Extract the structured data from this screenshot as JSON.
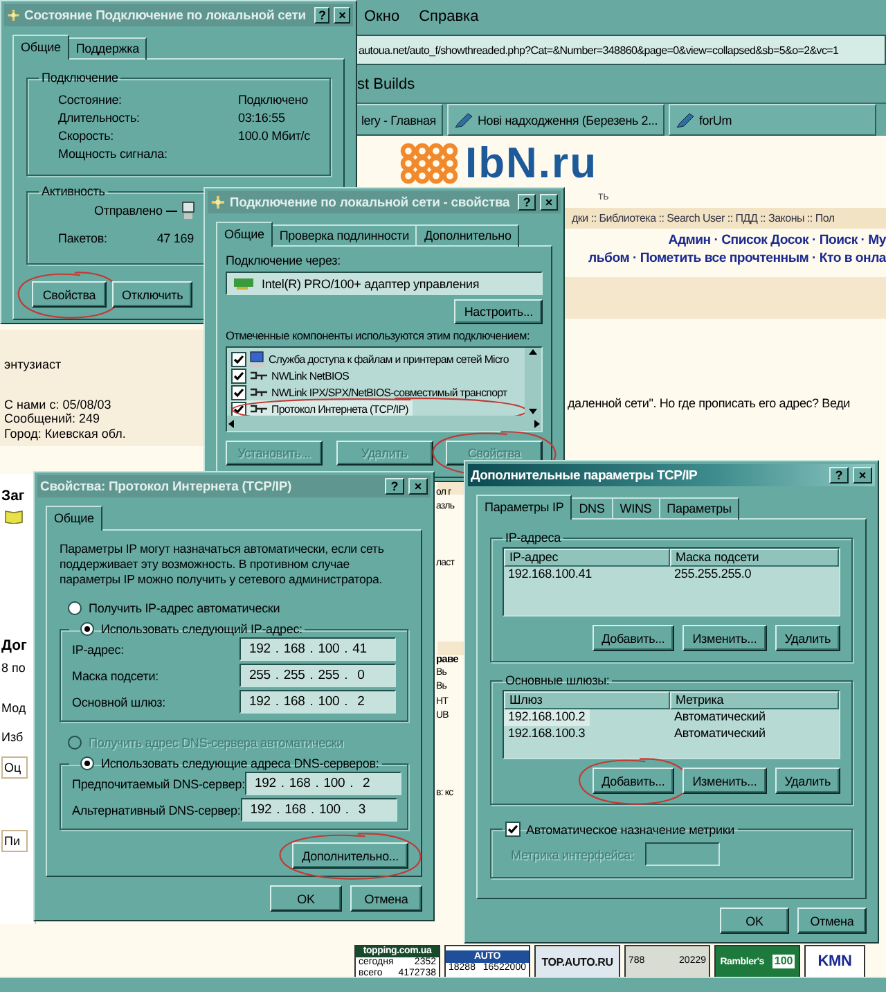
{
  "browser": {
    "menu": [
      {
        "label": "Окно"
      },
      {
        "label": "Справка"
      }
    ],
    "address": "autoua.net/auto_f/showthreaded.php?Cat=&Number=348860&page=0&view=collapsed&sb=5&o=2&vc=1",
    "links": [
      "st Builds"
    ],
    "tabs": [
      {
        "label": "lery - Главная",
        "kind": "plain"
      },
      {
        "label": "Нові надходження (Березень 2...",
        "kind": "edit"
      },
      {
        "label": "forUm",
        "kind": "edit"
      }
    ],
    "logo": {
      "text": "IbN.ru",
      "tagline": "ть"
    },
    "nav": "дки :: Библиотека :: Search User :: ПДД :: Законы :: Пол",
    "actions": [
      "Админ · Список Досок · Поиск · Му",
      "льбом · Пометить все прочтенным · Кто в онла"
    ],
    "profile": [
      "энтузиаст",
      "С нами с: 05/08/03",
      "Сообщений: 249",
      "Город: Киевская обл."
    ],
    "post": "даленной сети\". Но где прописать его адрес? Веди",
    "left_fragments": [
      {
        "text": "Заг",
        "kind": "heading"
      },
      {
        "text": "Дог",
        "kind": "heading"
      },
      {
        "text": "8 по",
        "kind": "text"
      },
      {
        "text": "Мод",
        "kind": "text"
      },
      {
        "text": "Изб",
        "kind": "text"
      },
      {
        "text": "Оц",
        "kind": "boxed"
      },
      {
        "text": "Пи",
        "kind": "boxed"
      }
    ],
    "middle_fragments": [
      {
        "text": "ол г",
        "kind": "text"
      },
      {
        "text": "азль",
        "kind": "text"
      },
      {
        "text": "ласт",
        "kind": "text"
      },
      {
        "text": "раве",
        "kind": "heading"
      },
      {
        "text": "Вь",
        "kind": "text"
      },
      {
        "text": "Вь",
        "kind": "text"
      },
      {
        "text": "НТ",
        "kind": "text"
      },
      {
        "text": "UB",
        "kind": "text"
      },
      {
        "text": "в: кс",
        "kind": "text"
      }
    ],
    "banners": [
      {
        "kind": "dark",
        "title": "topping.com.ua",
        "rows": [
          [
            "сегодня",
            "2352"
          ],
          [
            "всего",
            "4172738"
          ]
        ]
      },
      {
        "kind": "blue",
        "title": "AUTO",
        "rows": [
          [
            "18288",
            "16522000"
          ]
        ]
      },
      {
        "kind": "light",
        "title": "TOP.AUTO.RU"
      },
      {
        "kind": "grey",
        "rows": [
          [
            "788",
            "20229"
          ]
        ]
      },
      {
        "kind": "green",
        "title": "Rambler's",
        "badge": "100"
      },
      {
        "kind": "white",
        "title": "KMN"
      }
    ]
  },
  "status_dialog": {
    "title": "Состояние Подключение по локальной сети",
    "active": false,
    "controls": [
      "?",
      "×"
    ],
    "tabs": [
      {
        "label": "Общие",
        "selected": true
      },
      {
        "label": "Поддержка",
        "selected": false
      }
    ],
    "connection": {
      "legend": "Подключение",
      "rows": [
        {
          "label": "Состояние:",
          "value": "Подключено"
        },
        {
          "label": "Длительность:",
          "value": "03:16:55"
        },
        {
          "label": "Скорость:",
          "value": "100.0 Мбит/с"
        },
        {
          "label": "Мощность сигнала:"
        }
      ]
    },
    "activity": {
      "legend": "Активность",
      "sent": "Отправлено",
      "packets_label": "Пакетов:",
      "packets": "47 169"
    },
    "buttons": [
      {
        "label": "Свойства",
        "circled": true
      },
      {
        "label": "Отключить",
        "circled": false
      }
    ]
  },
  "properties_dialog": {
    "title": "Подключение по локальной сети - свойства",
    "active": false,
    "controls": [
      "?",
      "×"
    ],
    "tabs": [
      {
        "label": "Общие",
        "selected": true
      },
      {
        "label": "Проверка подлинности",
        "selected": false
      },
      {
        "label": "Дополнительно",
        "selected": false
      }
    ],
    "connect_label": "Подключение через:",
    "adapter": "Intel(R) PRO/100+ адаптер управления",
    "configure": {
      "label": "Настроить...",
      "circled": false
    },
    "components_label": "Отмеченные компоненты используются этим подключением:",
    "components": [
      {
        "label": "Служба доступа к файлам и принтерам сетей Micro",
        "kind": "service",
        "checked": true,
        "selected": false,
        "circled": false
      },
      {
        "label": "NWLink NetBIOS",
        "kind": "protocol",
        "checked": true,
        "selected": false,
        "circled": false
      },
      {
        "label": "NWLink IPX/SPX/NetBIOS-совместимый транспорт",
        "kind": "protocol",
        "checked": true,
        "selected": false,
        "circled": false
      },
      {
        "label": "Протокол Интернета (TCP/IP)",
        "kind": "protocol",
        "checked": true,
        "selected": true,
        "circled": true
      }
    ],
    "buttons": [
      {
        "label": "Установить...",
        "disabled": true,
        "circled": false
      },
      {
        "label": "Удалить",
        "disabled": true,
        "circled": false
      },
      {
        "label": "Свойства",
        "disabled": true,
        "circled": true
      }
    ]
  },
  "tcpip_dialog": {
    "title": "Свойства: Протокол Интернета (TCP/IP)",
    "active": false,
    "controls": [
      "?",
      "×"
    ],
    "tabs": [
      {
        "label": "Общие",
        "selected": true
      }
    ],
    "intro": "Параметры IP могут назначаться автоматически, если сеть поддерживает эту возможность. В противном случае параметры IP можно получить у сетевого администратора.",
    "ip_options": [
      {
        "label": "Получить IP-адрес автоматически",
        "selected": false,
        "disabled": false
      },
      {
        "label": "Использовать следующий IP-адрес:",
        "selected": true,
        "disabled": false
      }
    ],
    "ip_fields": [
      {
        "label": "IP-адрес:",
        "value": "192 . 168 . 100 . 41"
      },
      {
        "label": "Маска подсети:",
        "value": "255 . 255 . 255 .  0"
      },
      {
        "label": "Основной шлюз:",
        "value": "192 . 168 . 100 .  2"
      }
    ],
    "dns_options": [
      {
        "label": "Получить адрес DNS-сервера автоматически",
        "selected": false,
        "disabled": true
      },
      {
        "label": "Использовать следующие адреса DNS-серверов:",
        "selected": true,
        "disabled": false
      }
    ],
    "dns_fields": [
      {
        "label": "Предпочитаемый DNS-сервер:",
        "value": "192 . 168 . 100 .  2"
      },
      {
        "label": "Альтернативный DNS-сервер:",
        "value": "192 . 168 . 100 .  3"
      }
    ],
    "advanced": {
      "label": "Дополнительно...",
      "circled": true
    },
    "buttons": [
      {
        "label": "OK",
        "circled": false
      },
      {
        "label": "Отмена",
        "circled": false
      }
    ]
  },
  "advanced_dialog": {
    "title": "Дополнительные параметры TCP/IP",
    "active": true,
    "controls": [
      "?",
      "×"
    ],
    "tabs": [
      {
        "label": "Параметры IP",
        "selected": true
      },
      {
        "label": "DNS",
        "selected": false
      },
      {
        "label": "WINS",
        "selected": false
      },
      {
        "label": "Параметры",
        "selected": false
      }
    ],
    "ip_group": {
      "legend": "IP-адреса",
      "columns": [
        "IP-адрес",
        "Маска подсети"
      ],
      "rows": [
        {
          "cells": [
            "192.168.100.41",
            "255.255.255.0"
          ],
          "selected": false
        }
      ],
      "buttons": [
        {
          "label": "Добавить...",
          "circled": false
        },
        {
          "label": "Изменить...",
          "circled": false
        },
        {
          "label": "Удалить",
          "circled": false
        }
      ]
    },
    "gateway_group": {
      "legend": "Основные шлюзы:",
      "columns": [
        "Шлюз",
        "Метрика"
      ],
      "rows": [
        {
          "cells": [
            "192.168.100.2",
            "Автоматический"
          ],
          "selected": true
        },
        {
          "cells": [
            "192.168.100.3",
            "Автоматический"
          ],
          "selected": false
        }
      ],
      "buttons": [
        {
          "label": "Добавить...",
          "circled": true
        },
        {
          "label": "Изменить...",
          "circled": false
        },
        {
          "label": "Удалить",
          "circled": false
        }
      ]
    },
    "auto_metric": {
      "label": "Автоматическое назначение метрики",
      "checked": true
    },
    "metric": {
      "label": "Метрика интерфейса:",
      "disabled": true
    },
    "buttons": [
      {
        "label": "OK",
        "circled": false
      },
      {
        "label": "Отмена",
        "circled": false
      }
    ]
  }
}
